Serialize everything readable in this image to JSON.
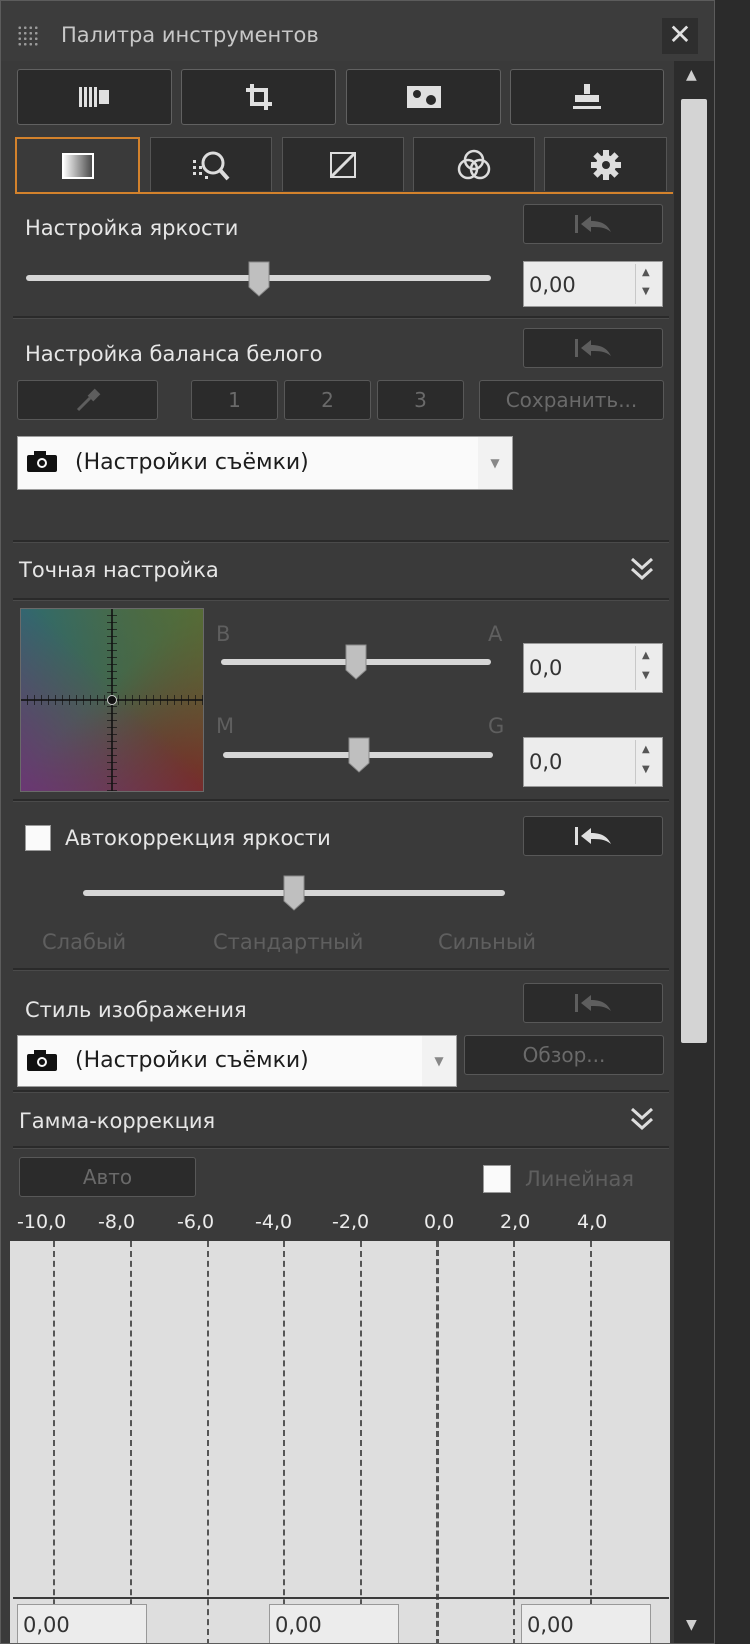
{
  "window": {
    "title": "Палитра инструментов",
    "close_glyph": "✕"
  },
  "toolbar": {
    "buttons": [
      {
        "icon": "film-strip-icon"
      },
      {
        "icon": "crop-icon"
      },
      {
        "icon": "image-dust-icon"
      },
      {
        "icon": "stamp-icon"
      }
    ]
  },
  "tabs": [
    {
      "icon": "brightness-gradient-icon",
      "active": true
    },
    {
      "icon": "magnifier-grid-icon",
      "active": false
    },
    {
      "icon": "curve-icon",
      "active": false
    },
    {
      "icon": "color-circles-icon",
      "active": false
    },
    {
      "icon": "gear-icon",
      "active": false
    }
  ],
  "brightness": {
    "label": "Настройка яркости",
    "value": "0,00",
    "slider_fraction": 0.5
  },
  "white_balance": {
    "label": "Настройка баланса белого",
    "preset_1": "1",
    "preset_2": "2",
    "preset_3": "3",
    "save_label": "Сохранить...",
    "selection": "(Настройки съёмки)"
  },
  "fine_tune": {
    "label": "Точная настройка",
    "b_label": "B",
    "a_label": "A",
    "ba_value": "0,0",
    "m_label": "M",
    "g_label": "G",
    "mg_value": "0,0"
  },
  "auto_brightness": {
    "label": "Автокоррекция яркости",
    "checked": false,
    "low_label": "Слабый",
    "standard_label": "Стандартный",
    "high_label": "Сильный"
  },
  "picture_style": {
    "label": "Стиль изображения",
    "selection": "(Настройки съёмки)",
    "browse_label": "Обзор..."
  },
  "gamma": {
    "label": "Гамма-коррекция",
    "auto_label": "Авто",
    "linear_label": "Линейная",
    "ticks": [
      "-10,0",
      "-8,0",
      "-6,0",
      "-4,0",
      "-2,0",
      "0,0",
      "2,0",
      "4,0"
    ],
    "bottom_values": [
      "0,00",
      "0,00",
      "0,00"
    ]
  },
  "colors": {
    "accent": "#d3822c",
    "panel": "#3a3a3a"
  }
}
